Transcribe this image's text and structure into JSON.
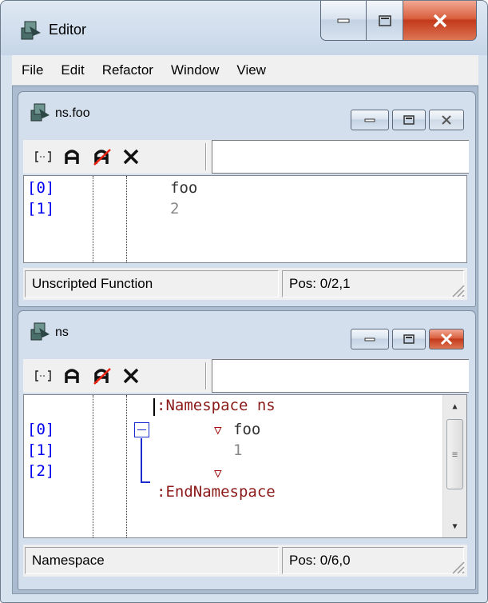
{
  "window": {
    "title": "Editor"
  },
  "menu": [
    "File",
    "Edit",
    "Refactor",
    "Window",
    "View"
  ],
  "child_top": {
    "title": "ns.foo",
    "search_value": "",
    "lines": [
      {
        "num": "[0]",
        "text": "foo"
      },
      {
        "num": "[1]",
        "text": "2"
      }
    ],
    "status_left": "Unscripted Function",
    "status_right": "Pos: 0/2,1"
  },
  "child_bottom": {
    "title": "ns",
    "search_value": "",
    "header_line": ":Namespace ns",
    "lines": [
      {
        "num": "[0]",
        "text": "foo"
      },
      {
        "num": "[1]",
        "text": "1"
      },
      {
        "num": "[2]",
        "text": ""
      }
    ],
    "footer_line": ":EndNamespace",
    "status_left": "Namespace",
    "status_right": "Pos: 0/6,0"
  },
  "colors": {
    "line_numbers": "#0000ee",
    "keyword": "#8b1a1a",
    "fold_marker": "#1a2bd0",
    "close_button": "#c8431f"
  },
  "icons": {
    "app": "editor-app-icon",
    "toolbar": [
      "bracket-icon",
      "stop-icon",
      "clear-stop-icon",
      "close-x-icon"
    ]
  }
}
